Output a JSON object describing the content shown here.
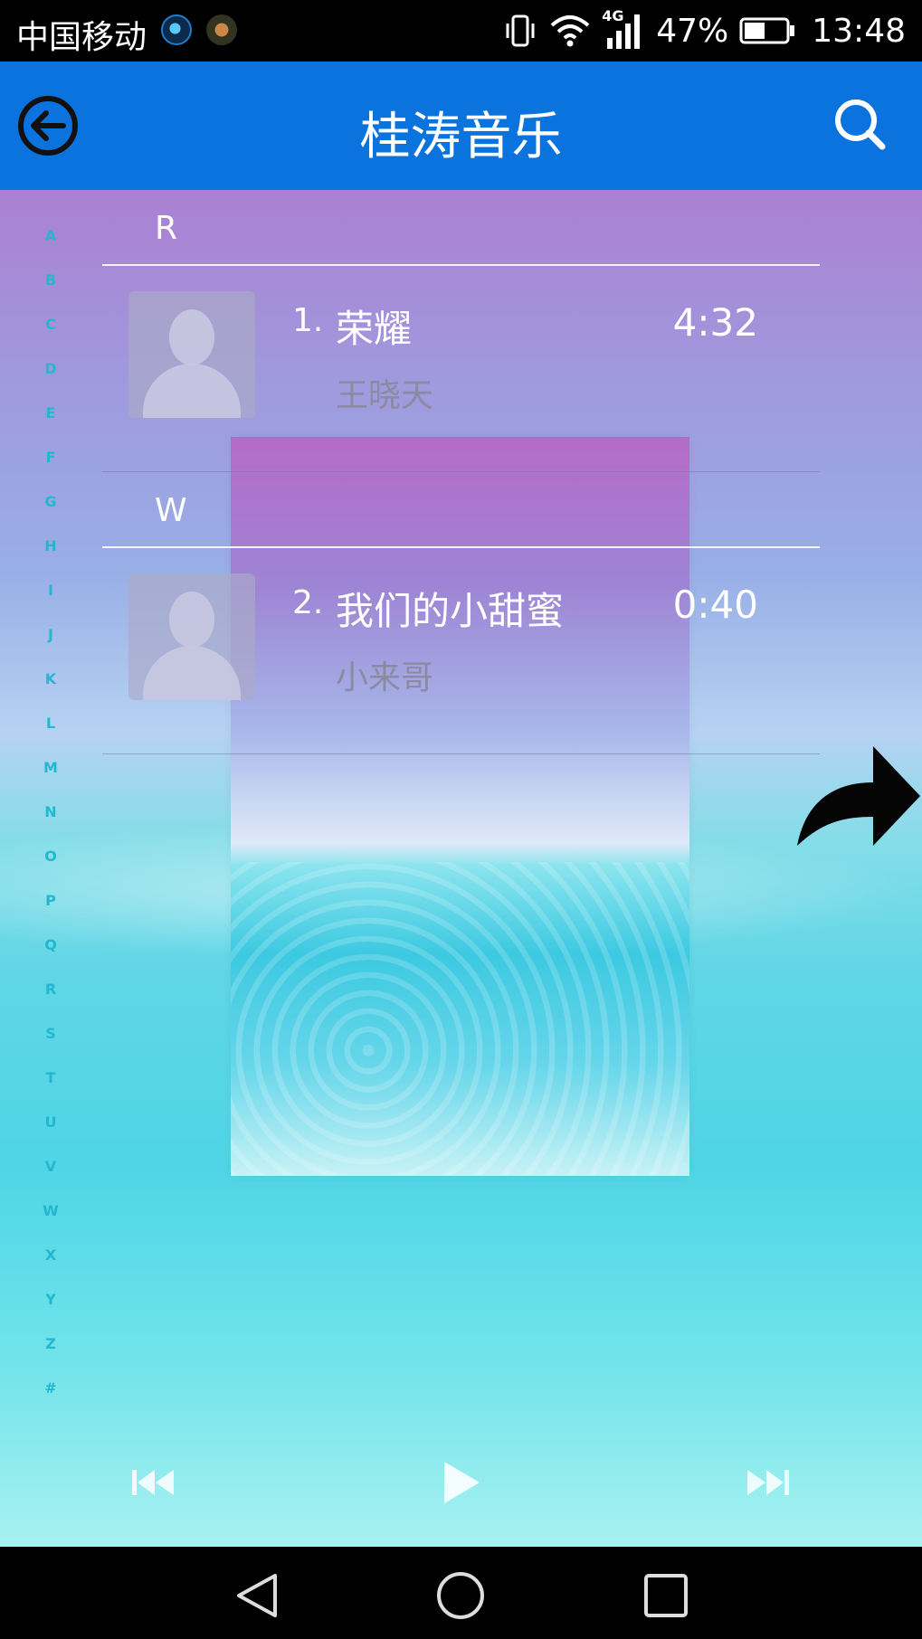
{
  "status_bar": {
    "carrier": "中国移动",
    "network": "4G",
    "battery": "47%",
    "time": "13:48"
  },
  "app_bar": {
    "title": "桂涛音乐"
  },
  "alphabet": [
    "A",
    "B",
    "C",
    "D",
    "E",
    "F",
    "G",
    "H",
    "I",
    "J",
    "K",
    "L",
    "M",
    "N",
    "O",
    "P",
    "Q",
    "R",
    "S",
    "T",
    "U",
    "V",
    "W",
    "X",
    "Y",
    "Z",
    "#"
  ],
  "sections": [
    {
      "letter": "R",
      "songs": [
        {
          "index": "1.",
          "title": "荣耀",
          "duration": "4:32",
          "artist": "王晓天"
        }
      ]
    },
    {
      "letter": "W",
      "songs": [
        {
          "index": "2.",
          "title": "我们的小甜蜜",
          "duration": "0:40",
          "artist": "小来哥"
        }
      ]
    }
  ],
  "colors": {
    "app_bar": "#0a73dd",
    "alphabet_index": "#23b8cf",
    "artist_text": "#8a8aa2"
  },
  "icons": {
    "back": "back-circle-arrow-icon",
    "search": "search-icon",
    "share": "share-arrow-icon",
    "prev": "skip-previous-icon",
    "play": "play-icon",
    "next": "skip-next-icon"
  }
}
